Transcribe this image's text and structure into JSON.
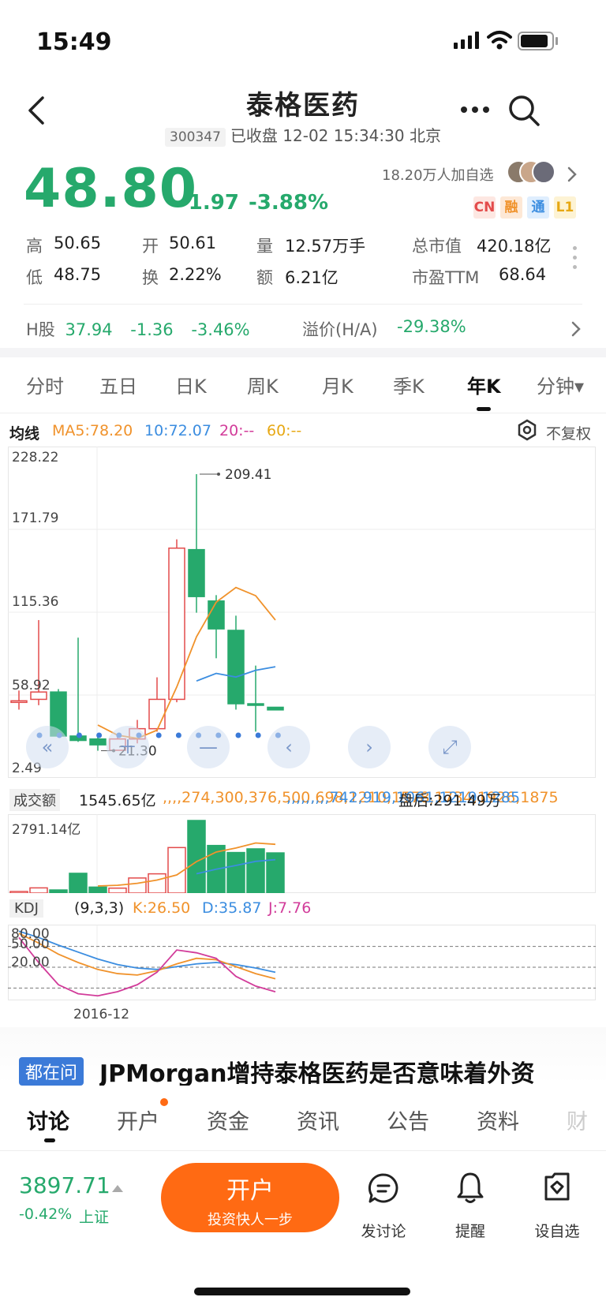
{
  "status_bar": {
    "time": "15:49"
  },
  "header": {
    "title": "泰格医药",
    "code": "300347",
    "status": "已收盘 12-02 15:34:30 北京"
  },
  "quote": {
    "price": "48.80",
    "change": "-1.97",
    "change_pct": "-3.88%",
    "watchers": "18.20万人加自选",
    "tags": [
      "CN",
      "融",
      "通",
      "L1"
    ],
    "stats": [
      {
        "label": "高",
        "value": "50.65",
        "color": "green"
      },
      {
        "label": "开",
        "value": "50.61",
        "color": "green"
      },
      {
        "label": "量",
        "value": "12.57万手",
        "color": "normal"
      },
      {
        "label": "总市值",
        "value": "420.18亿",
        "color": "normal"
      },
      {
        "label": "低",
        "value": "48.75",
        "color": "green"
      },
      {
        "label": "换",
        "value": "2.22%",
        "color": "normal"
      },
      {
        "label": "额",
        "value": "6.21亿",
        "color": "normal"
      },
      {
        "label": "市盈TTM",
        "value": "68.64",
        "color": "normal"
      }
    ],
    "h_share": {
      "label": "H股",
      "price": "37.94",
      "change": "-1.36",
      "change_pct": "-3.46%"
    },
    "premium": {
      "label": "溢价(H/A)",
      "value": "-29.38%"
    }
  },
  "period_tabs": [
    "分时",
    "五日",
    "日K",
    "周K",
    "月K",
    "季K",
    "年K",
    "分钟▾"
  ],
  "active_tab": "年K",
  "ma_legend": {
    "title": "均线",
    "ma5": "MA5:78.20",
    "ma10": "10:72.07",
    "ma20": "20:--",
    "ma60": "60:--",
    "adjust": "不复权"
  },
  "colors": {
    "up": "#e34b4b",
    "down": "#26a96c",
    "ma5": "#f0922b",
    "ma10": "#3b8de0",
    "ma20": "#d23c9a",
    "ma60": "#f2c01a",
    "accent": "#ff6a13"
  },
  "chart_data": {
    "type": "candlestick",
    "y_axis_labels": [
      "228.22",
      "171.79",
      "115.36",
      "58.92",
      "2.49"
    ],
    "ylim": [
      2.49,
      228.22
    ],
    "annotations": {
      "high": "209.41",
      "low": "21.30"
    },
    "candles": [
      {
        "o": 55,
        "c": 55,
        "h": 62,
        "l": 49
      },
      {
        "o": 56,
        "c": 61,
        "h": 110,
        "l": 52
      },
      {
        "o": 61,
        "c": 31,
        "h": 63,
        "l": 31
      },
      {
        "o": 31,
        "c": 28,
        "h": 98,
        "l": 27
      },
      {
        "o": 29,
        "c": 25,
        "h": 31,
        "l": 21
      },
      {
        "o": 21.3,
        "c": 29,
        "h": 31,
        "l": 21.3
      },
      {
        "o": 29,
        "c": 36,
        "h": 42,
        "l": 26
      },
      {
        "o": 36,
        "c": 56,
        "h": 71,
        "l": 34
      },
      {
        "o": 56,
        "c": 159,
        "h": 165,
        "l": 54
      },
      {
        "o": 158,
        "c": 126,
        "h": 209.41,
        "l": 115
      },
      {
        "o": 123,
        "c": 104,
        "h": 127,
        "l": 84
      },
      {
        "o": 103,
        "c": 53,
        "h": 113,
        "l": 49
      },
      {
        "o": 53,
        "c": 52,
        "h": 79,
        "l": 34
      },
      {
        "o": 50.61,
        "c": 48.8,
        "h": 50.65,
        "l": 48.75
      }
    ],
    "ma5": [
      null,
      null,
      null,
      null,
      38.5,
      31.6,
      29.4,
      35.0,
      64.4,
      98.6,
      122.2,
      132.2,
      126.6,
      110.0
    ],
    "ma10": [
      null,
      null,
      null,
      null,
      null,
      null,
      null,
      null,
      null,
      68.5,
      73.7,
      71.2,
      75.8,
      78.2
    ],
    "volume": {
      "label": "成交额",
      "value": "1545.65亿",
      "ma5": [
        null,
        null,
        null,
        null,
        274,
        300,
        376,
        500,
        698,
        1210,
        1578,
        1734,
        1926,
        1875
      ],
      "ma10": [
        null,
        null,
        null,
        null,
        null,
        null,
        null,
        null,
        null,
        742,
        919,
        1061,
        1219,
        1285
      ],
      "after_hours": "盘后:291.49万",
      "max_label": "2791.14亿",
      "bars": [
        60,
        200,
        120,
        760,
        230,
        190,
        580,
        740,
        1750,
        2791,
        1830,
        1560,
        1700,
        1545
      ]
    },
    "kdj": {
      "label": "KDJ",
      "params": "(9,3,3)",
      "k": "K:26.50",
      "d": "D:35.87",
      "j": "J:7.76",
      "levels": [
        "80.00",
        "50.00",
        "20.00"
      ],
      "x_label": "2016-12",
      "k_series": [
        92,
        78,
        62,
        50,
        40,
        34,
        32,
        38,
        48,
        56,
        54,
        44,
        34,
        26.5
      ],
      "d_series": [
        95,
        86,
        75,
        65,
        55,
        47,
        42,
        40,
        44,
        48,
        50,
        47,
        42,
        35.9
      ],
      "j_series": [
        86,
        50,
        18,
        5,
        2,
        8,
        18,
        36,
        68,
        64,
        56,
        30,
        16,
        7.8
      ]
    }
  },
  "news": {
    "badge": "都在问",
    "headline": "JPMorgan增持泰格医药是否意味着外资"
  },
  "bottom_tabs": [
    "讨论",
    "开户",
    "资金",
    "资讯",
    "公告",
    "资料",
    "财"
  ],
  "active_bottom_tab": "讨论",
  "index": {
    "value": "3897.71",
    "change": "-0.42%",
    "name": "上证"
  },
  "action_bar": {
    "open_account": "开户",
    "open_account_sub": "投资快人一步",
    "post": "发讨论",
    "alert": "提醒",
    "watchlist": "设自选"
  }
}
